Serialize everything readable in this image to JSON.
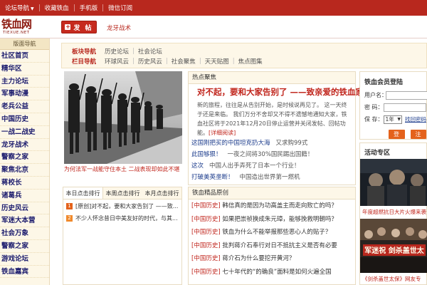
{
  "topbar": {
    "items": [
      "论坛导航",
      "收藏铁血",
      "手机版",
      "微信订阅"
    ]
  },
  "logo": {
    "cn": "铁血网",
    "en": "TIEXUE.NET"
  },
  "header": {
    "post_label": "发  帖",
    "post_icon": "plus-icon",
    "link": "龙牙战术"
  },
  "sidebar": {
    "title": "版面导航",
    "items": [
      "社区首页",
      "精华区",
      "主力论坛",
      "军事动漫",
      "老兵公益",
      "中国历史",
      "一战二战史",
      "龙牙战术",
      "警察之家",
      "聚焦北京",
      "蒋校长",
      "诸葛兵",
      "历史风云",
      "军迷大本营",
      "社会万象",
      "警察之家",
      "游戏论坛",
      "铁血嘉宾"
    ]
  },
  "subnav": {
    "label1": "板块导航",
    "row1": [
      "历史论坛",
      "社会论坛"
    ],
    "label2": "栏目导航",
    "row2": [
      "环球风云",
      "历史风云",
      "社会聚焦",
      "天天贴图",
      "焦点图集"
    ]
  },
  "photo": {
    "caption": "为何法军一战能守住本土 二战表现却如此不堪"
  },
  "hot": {
    "header": "热点聚焦",
    "title": "对不起，要和大家告别了 ——致亲爱的铁血家人",
    "summary": "新的旅程，往往是从告别开始，是时候说再见了。 这一天终于还是来临。 我们万分不舍却又不得不遗憾地通知大家，铁血社区将于2021年12月20日停止运营并关闭发帖、回帖功能。",
    "detail": "[详细阅读]",
    "news": [
      {
        "link": "这国刚把买的中国坦克扔大海",
        "note": "又求购99式"
      },
      {
        "link": "此国够狠！",
        "note": "一夜之间将30%国民踢出国籍！"
      },
      {
        "link": "这次",
        "note": "中国人出手弄死了日本一个行业！"
      },
      {
        "link": "打破美英垄断！",
        "note": "中国造出世界第一燃机"
      }
    ]
  },
  "rank": {
    "tabs": [
      "本日点击排行",
      "本周点击排行",
      "本月点击排行"
    ],
    "items": [
      {
        "num": "1",
        "text": "[原创]对不起，要和大家告别了 ——致..."
      },
      {
        "num": "2",
        "text": "不少人怀念昔日中美友好的时代，与其..."
      }
    ]
  },
  "orig": {
    "header": "铁血精品原创",
    "items": [
      {
        "cat": "[中国历史]",
        "text": "韩信真的是因为功高盖主而走向败亡的吗？"
      },
      {
        "cat": "[中国历史]",
        "text": "如果把崇祯换成朱元璋，能够挽救明朝吗？"
      },
      {
        "cat": "[中国历史]",
        "text": "铁血为什么不能举报那些恶心人的贴子？"
      },
      {
        "cat": "[中国历史]",
        "text": "批判蒋介石奉行对日不抵抗主义是否有必要"
      },
      {
        "cat": "[中国历史]",
        "text": "蒋介石为什么要挖开黄河？"
      },
      {
        "cat": "[中国历史]",
        "text": "七十年代的“的确良”面料是如何火遍全国"
      }
    ]
  },
  "login": {
    "title": "铁血会员登陆",
    "username_label": "用户名：",
    "password_label": "密  码：",
    "keep_label": "保  存：",
    "keep_value": "1年",
    "keep_note": "找回密码",
    "login_btn": "登录",
    "register_btn": "注册"
  },
  "activity": {
    "title": "活动专区",
    "caption1": "年度超燃抗日大片火爆来袭",
    "caption2": "《剑杀盖世太保》网友专"
  },
  "colors": {
    "brand_red": "#b8281e",
    "link_blue": "#1c3c8c",
    "accent_orange": "#e4621b"
  }
}
